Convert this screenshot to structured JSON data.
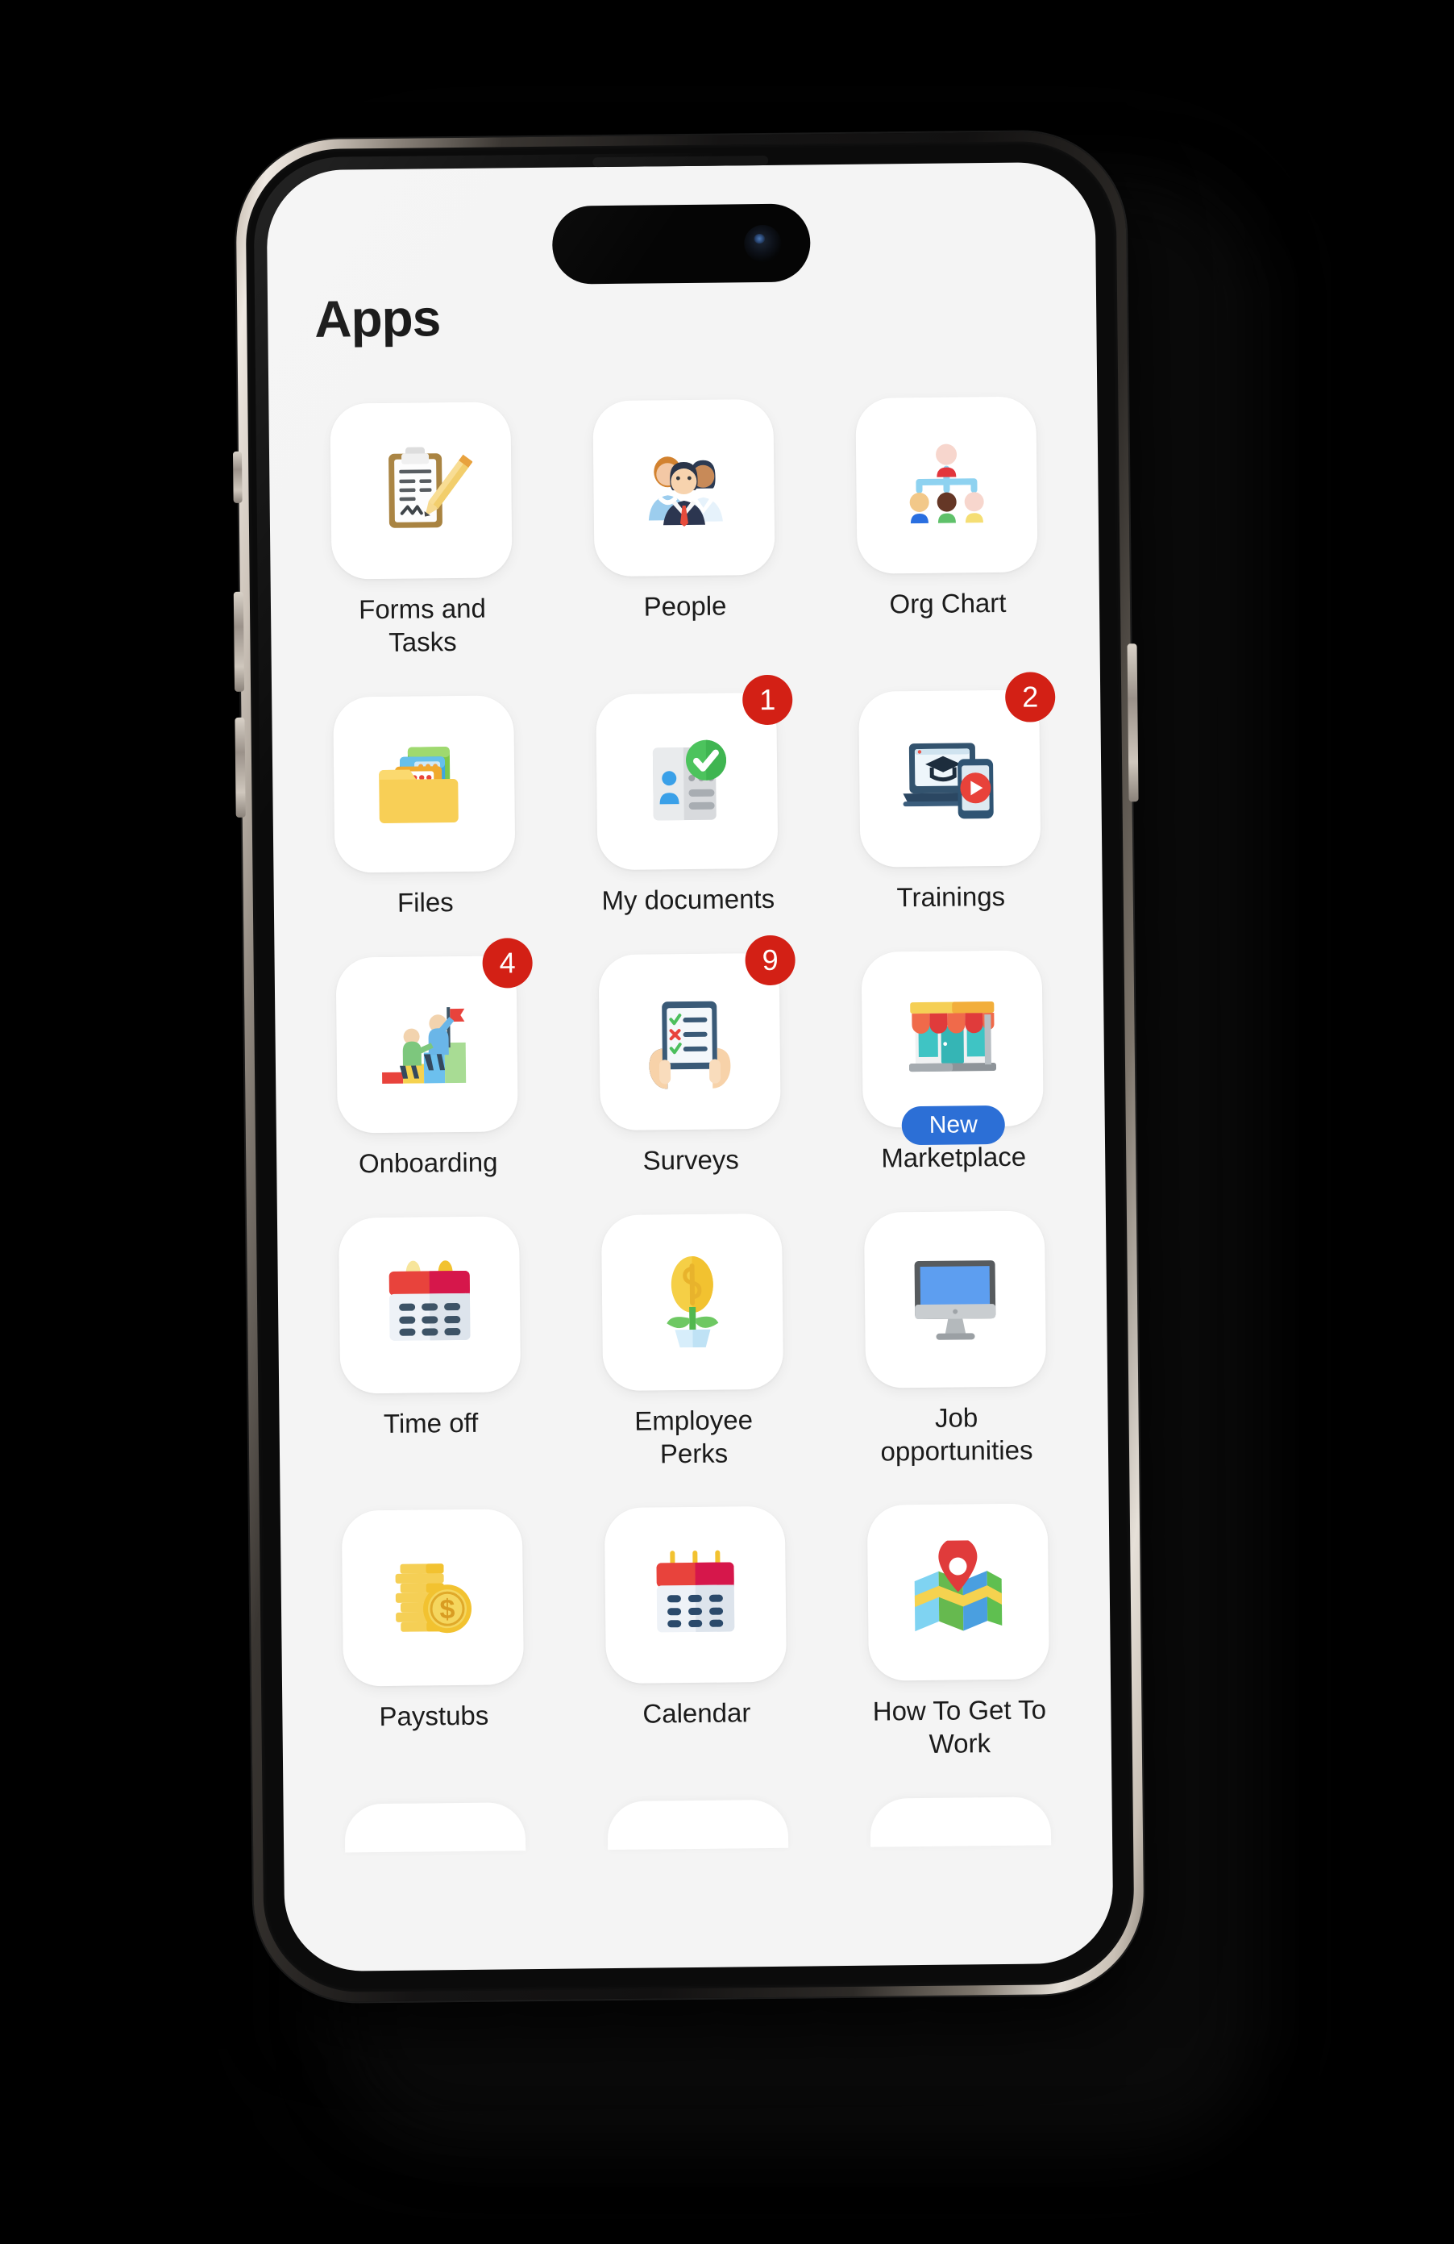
{
  "screen": {
    "title": "Apps",
    "background_color": "#f4f4f4"
  },
  "theme": {
    "badge_color": "#d32015",
    "new_pill_color": "#2c6fd6",
    "tile_color": "#ffffff",
    "label_color": "#1b1b1b"
  },
  "apps": [
    {
      "label": "Forms and Tasks",
      "icon": "clipboard-pencil-icon",
      "badge": null,
      "pill": null
    },
    {
      "label": "People",
      "icon": "group-of-people-icon",
      "badge": null,
      "pill": null
    },
    {
      "label": "Org Chart",
      "icon": "org-chart-icon",
      "badge": null,
      "pill": null
    },
    {
      "label": "Files",
      "icon": "folder-stack-icon",
      "badge": null,
      "pill": null
    },
    {
      "label": "My documents",
      "icon": "id-card-check-icon",
      "badge": "1",
      "pill": null
    },
    {
      "label": "Trainings",
      "icon": "laptop-phone-graduation-icon",
      "badge": "2",
      "pill": null
    },
    {
      "label": "Onboarding",
      "icon": "climbing-stairs-flag-icon",
      "badge": "4",
      "pill": null
    },
    {
      "label": "Surveys",
      "icon": "hands-tablet-checklist-icon",
      "badge": "9",
      "pill": null
    },
    {
      "label": "Marketplace",
      "icon": "storefront-icon",
      "badge": null,
      "pill": "New"
    },
    {
      "label": "Time off",
      "icon": "calendar-pins-icon",
      "badge": null,
      "pill": null
    },
    {
      "label": "Employee Perks",
      "icon": "money-plant-icon",
      "badge": null,
      "pill": null
    },
    {
      "label": "Job opportunities",
      "icon": "desktop-monitor-icon",
      "badge": null,
      "pill": null
    },
    {
      "label": "Paystubs",
      "icon": "cash-coin-icon",
      "badge": null,
      "pill": null
    },
    {
      "label": "Calendar",
      "icon": "calendar-icon",
      "badge": null,
      "pill": null
    },
    {
      "label": "How To Get To Work",
      "icon": "map-pin-icon",
      "badge": null,
      "pill": null
    }
  ],
  "device": {
    "hardware_buttons": [
      "mute-switch",
      "volume-up-button",
      "volume-down-button",
      "power-button"
    ],
    "notch": "dynamic-island"
  }
}
